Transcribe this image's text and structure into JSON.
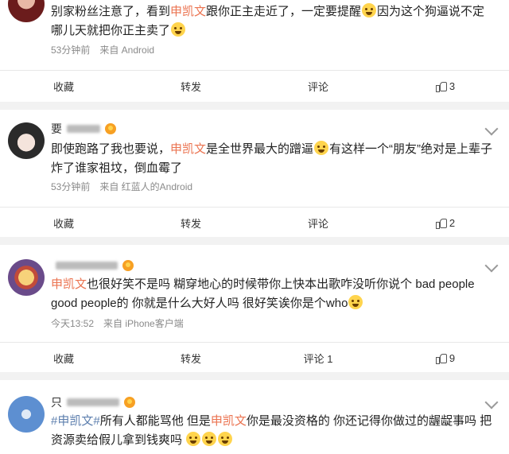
{
  "posts": [
    {
      "segments": [
        {
          "t": "别家粉丝注意了，看到",
          "c": ""
        },
        {
          "t": "申凯文",
          "c": "hl"
        },
        {
          "t": "跟你正主走近了，一定要提醒",
          "c": ""
        },
        {
          "t": "",
          "c": "emoji"
        },
        {
          "t": "因为这个狗逼说不定哪儿天就把你正主卖了",
          "c": ""
        },
        {
          "t": "",
          "c": "emoji"
        }
      ],
      "meta": "53分钟前　来自 Android",
      "actions": {
        "repost": "收藏",
        "forward": "转发",
        "comment": "评论",
        "likes": "3"
      }
    },
    {
      "name": "要",
      "segments": [
        {
          "t": "即使跑路了我也要说，",
          "c": ""
        },
        {
          "t": "申凯文",
          "c": "hl"
        },
        {
          "t": "是全世界最大的蹭逼",
          "c": ""
        },
        {
          "t": "",
          "c": "emoji"
        },
        {
          "t": "有这样一个“朋友”绝对是上辈子炸了谁家祖坟，倒血霉了",
          "c": ""
        }
      ],
      "meta": "53分钟前　来自 红蓝人的Android",
      "actions": {
        "repost": "收藏",
        "forward": "转发",
        "comment": "评论",
        "likes": "2"
      }
    },
    {
      "name": "",
      "segments": [
        {
          "t": "申凯文",
          "c": "hl"
        },
        {
          "t": "也很好笑不是吗 糊穿地心的时候带你上快本出歌咋没听你说个 bad people good people的 你就是什么大好人吗 很好笑诶你是个who",
          "c": ""
        },
        {
          "t": "",
          "c": "emoji"
        }
      ],
      "meta": "今天13:52　来自 iPhone客户端",
      "actions": {
        "repost": "收藏",
        "forward": "转发",
        "comment": "评论 1",
        "likes": "9"
      }
    },
    {
      "name": "只",
      "segments": [
        {
          "t": "#申凯文#",
          "c": "tag"
        },
        {
          "t": "所有人都能骂他 但是",
          "c": ""
        },
        {
          "t": "申凯文",
          "c": "hl"
        },
        {
          "t": "你是最没资格的 你还记得你做过的龌龊事吗 把资源卖给假儿拿到钱爽吗 ",
          "c": ""
        },
        {
          "t": "",
          "c": "emoji"
        },
        {
          "t": "",
          "c": "emoji"
        },
        {
          "t": "",
          "c": "emoji"
        }
      ]
    }
  ]
}
